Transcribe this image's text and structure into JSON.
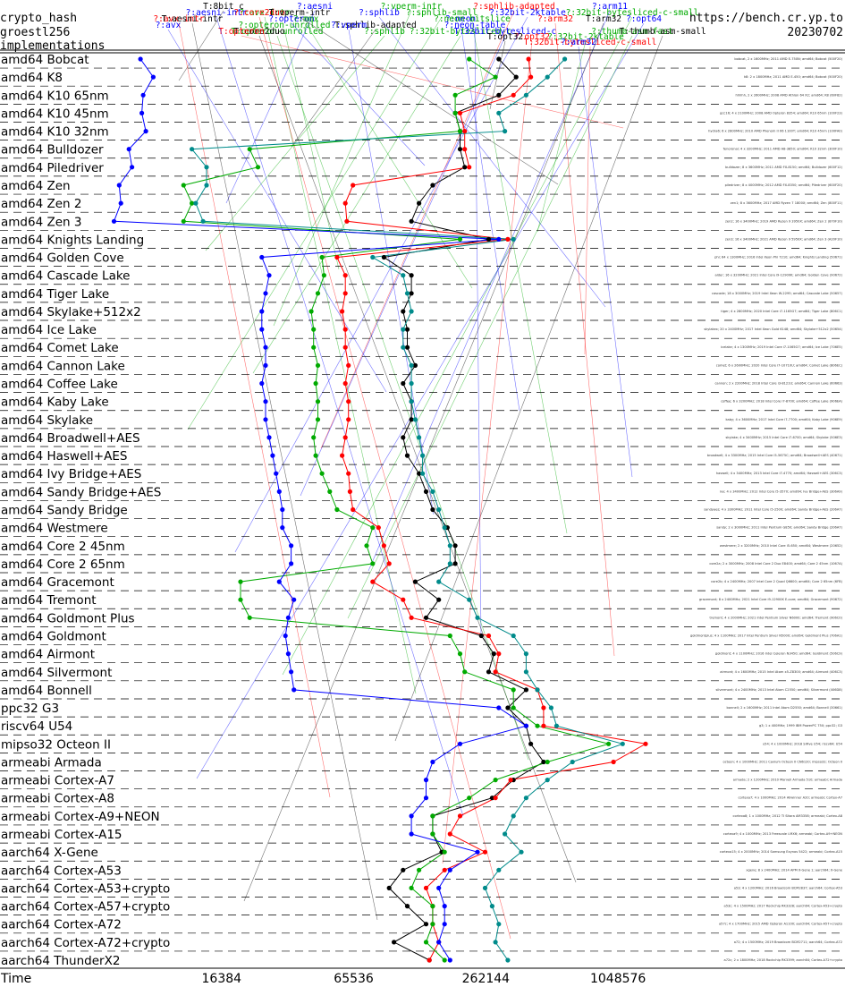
{
  "header": {
    "primitive": "crypto_hash",
    "function": "groestl256",
    "section": "implementations",
    "url": "https://bench.cr.yp.to",
    "date": "20230702"
  },
  "legend": [
    {
      "label": "T:8bit_c",
      "color": "#000000"
    },
    {
      "label": "?:aesni",
      "color": "#0000ff"
    },
    {
      "label": "?:vperm-intr",
      "color": "#00aa00"
    },
    {
      "label": "?:sphlib-adapted",
      "color": "#ff0000"
    },
    {
      "label": "?:arm11",
      "color": "#0000ff"
    },
    {
      "label": "?:avx-intr",
      "color": "#00aa00"
    },
    {
      "label": "?:aesni-intr",
      "color": "#0000ff"
    },
    {
      "label": "?:core2duo",
      "color": "#ff0000"
    },
    {
      "label": "T:vperm-intr",
      "color": "#000000"
    },
    {
      "label": "?:sphlib",
      "color": "#0000ff"
    },
    {
      "label": "?:sphlib-small",
      "color": "#00aa00"
    },
    {
      "label": "?:32bit-2ktable",
      "color": "#0000ff"
    },
    {
      "label": "?:32bit-bytesliced-c-small",
      "color": "#00aa00"
    },
    {
      "label": "?:avx-intr",
      "color": "#ff0000"
    },
    {
      "label": "T:aesni-intr",
      "color": "#000000"
    },
    {
      "label": "?:opteron",
      "color": "#0000ff"
    },
    {
      "label": "?:mmx",
      "color": "#00aa00"
    },
    {
      "label": "?:neon",
      "color": "#0000ff"
    },
    {
      "label": "?:neon-bitslice",
      "color": "#00aa00"
    },
    {
      "label": "?:arm32",
      "color": "#ff0000"
    },
    {
      "label": "?:opt64",
      "color": "#0000ff"
    },
    {
      "label": "T:arm32",
      "color": "#000000"
    },
    {
      "label": "T:sphlib-adapted",
      "color": "#000000"
    },
    {
      "label": "?:opteron-unrolled",
      "color": "#00aa00"
    },
    {
      "label": "?:avx",
      "color": "#0000ff"
    },
    {
      "label": "?:vperm",
      "color": "#0000ff"
    },
    {
      "label": "?:neon-table",
      "color": "#0000ff"
    },
    {
      "label": "T:opteron-unrolled",
      "color": "#00aa00"
    },
    {
      "label": "T:core2duo",
      "color": "#000000"
    },
    {
      "label": "T:opteron",
      "color": "#ff0000"
    },
    {
      "label": "?:sphlib",
      "color": "#00aa00"
    },
    {
      "label": "?:32bit-bytesliced-c",
      "color": "#00aa00"
    },
    {
      "label": "T:32bit-bytesliced-c",
      "color": "#0000ff"
    },
    {
      "label": "?:thumb-asm-fast",
      "color": "#00aa00"
    },
    {
      "label": "T:thumb-asm-small",
      "color": "#000000"
    },
    {
      "label": "?:opt32",
      "color": "#ff0000"
    },
    {
      "label": "T:opt32",
      "color": "#000000"
    },
    {
      "label": "?:32bit-2ktable",
      "color": "#00aa00"
    },
    {
      "label": "T:32bit-bytesliced-c-small",
      "color": "#ff0000"
    },
    {
      "label": "?:arm32",
      "color": "#0000ff"
    }
  ],
  "chart_data": {
    "type": "line",
    "title": "",
    "xlabel": "Time",
    "xscale": "log2",
    "xlim": [
      3800,
      2000000
    ],
    "xticks": [
      16384,
      65536,
      262144,
      1048576
    ],
    "xtick_labels": [
      "16384",
      "65536",
      "262144",
      "1048576"
    ],
    "grid": "dashed horizontal separators between rows",
    "categories": [
      "amd64 Bobcat",
      "amd64 K8",
      "amd64 K10 65nm",
      "amd64 K10 45nm",
      "amd64 K10 32nm",
      "amd64 Bulldozer",
      "amd64 Piledriver",
      "amd64 Zen",
      "amd64 Zen 2",
      "amd64 Zen 3",
      "amd64 Knights Landing",
      "amd64 Golden Cove",
      "amd64 Cascade Lake",
      "amd64 Tiger Lake",
      "amd64 Skylake+512x2",
      "amd64 Ice Lake",
      "amd64 Comet Lake",
      "amd64 Cannon Lake",
      "amd64 Coffee Lake",
      "amd64 Kaby Lake",
      "amd64 Skylake",
      "amd64 Broadwell+AES",
      "amd64 Haswell+AES",
      "amd64 Ivy Bridge+AES",
      "amd64 Sandy Bridge+AES",
      "amd64 Sandy Bridge",
      "amd64 Westmere",
      "amd64 Core 2 45nm",
      "amd64 Core 2 65nm",
      "amd64 Gracemont",
      "amd64 Tremont",
      "amd64 Goldmont Plus",
      "amd64 Goldmont",
      "amd64 Airmont",
      "amd64 Silvermont",
      "amd64 Bonnell",
      "ppc32 G3",
      "riscv64 U54",
      "mipso32 Octeon II",
      "armeabi Armada",
      "armeabi Cortex-A7",
      "armeabi Cortex-A8",
      "armeabi Cortex-A9+NEON",
      "armeabi Cortex-A15",
      "aarch64 X-Gene",
      "aarch64 Cortex-A53",
      "aarch64 Cortex-A53+crypto",
      "aarch64 Cortex-A57+crypto",
      "aarch64 Cortex-A72",
      "aarch64 Cortex-A72+crypto",
      "aarch64 ThunderX2"
    ],
    "series": [
      {
        "name": "8bit_c",
        "color": "#000000",
        "values": [
          300000,
          360000,
          300000,
          190000,
          200000,
          200000,
          210000,
          150000,
          130000,
          120000,
          270000,
          90000,
          120000,
          120000,
          110000,
          115000,
          115000,
          125000,
          110000,
          120000,
          120000,
          110000,
          115000,
          130000,
          140000,
          150000,
          175000,
          190000,
          190000,
          125000,
          160000,
          140000,
          250000,
          285000,
          270000,
          400000,
          330000,
          400000,
          420000,
          480000,
          350000,
          280000,
          150000,
          150000,
          165000,
          110000,
          95000,
          115000,
          140000,
          100000,
          145000
        ]
      },
      {
        "name": "sphlib-adapted",
        "color": "#ff0000",
        "values": [
          410000,
          420000,
          350000,
          200000,
          210000,
          210000,
          220000,
          65000,
          60000,
          61000,
          330000,
          55000,
          60000,
          60000,
          58000,
          60000,
          60000,
          62000,
          60000,
          62000,
          62000,
          60000,
          58000,
          62000,
          63000,
          65000,
          85000,
          90000,
          95000,
          80000,
          110000,
          120000,
          270000,
          300000,
          290000,
          450000,
          480000,
          480000,
          1400000,
          1000000,
          340000,
          290000,
          200000,
          180000,
          260000,
          170000,
          140000,
          150000,
          150000,
          160000,
          145000
        ]
      },
      {
        "name": "vperm-intr",
        "color": "#00aa00",
        "values": [
          220000,
          290000,
          190000,
          190000,
          200000,
          22000,
          24000,
          11000,
          12000,
          11000,
          200000,
          47000,
          48000,
          45000,
          42000,
          43000,
          43000,
          45000,
          44000,
          45000,
          45000,
          43000,
          44000,
          47000,
          51000,
          55000,
          80000,
          75000,
          80000,
          20000,
          20000,
          22000,
          180000,
          200000,
          210000,
          350000,
          350000,
          450000,
          950000,
          500000,
          290000,
          220000,
          150000,
          150000,
          170000,
          130000,
          120000,
          150000,
          150000,
          140000,
          170000
        ]
      },
      {
        "name": "opteron-unrolled",
        "color": "#008b8b",
        "values": [
          600000,
          500000,
          400000,
          300000,
          320000,
          12000,
          14000,
          14000,
          12500,
          13500,
          350000,
          80000,
          110000,
          115000,
          120000,
          110000,
          110000,
          120000,
          120000,
          120000,
          125000,
          130000,
          135000,
          135000,
          150000,
          160000,
          170000,
          180000,
          180000,
          160000,
          220000,
          240000,
          350000,
          400000,
          400000,
          450000,
          520000,
          550000,
          1100000,
          650000,
          500000,
          400000,
          350000,
          320000,
          380000,
          300000,
          260000,
          280000,
          300000,
          290000,
          330000
        ]
      },
      {
        "name": "aesni",
        "color": "#0000ff",
        "values": [
          7000,
          8000,
          7200,
          7100,
          7400,
          6200,
          6400,
          5600,
          5700,
          5300,
          300000,
          25000,
          27000,
          26000,
          25000,
          25000,
          26000,
          26000,
          25000,
          26000,
          26000,
          27000,
          28000,
          29000,
          30000,
          31000,
          31000,
          34000,
          34000,
          30000,
          35000,
          33000,
          32000,
          33000,
          34000,
          35000,
          300000,
          400000,
          200000,
          150000,
          140000,
          140000,
          120000,
          120000,
          240000,
          180000,
          160000,
          170000,
          170000,
          160000,
          180000
        ]
      }
    ]
  },
  "machines": [
    "bobcat, 2 x 1600MHz; 2011 AMD E-750N; amd64; Bobcat (500F20)",
    "k8: 2 x 1800MHz; 2011 AMD E-450; amd64; Bobcat (500F20)",
    "hhhhh, 2 x 2600MHz; 2008 AMD Athlon 64 X2; amd64; K8 (60F82)",
    "gcc16; 4 x 2100MHz; 2008 AMD Opteron 8354; amd64; K10 65nm (100F23)",
    "hydra6; 6 x 2800MHz; 2010 AMD Phenom II X6 1100T; amd64; K10 45nm (100FA0)",
    "fenoronal; 4 x 3200MHz; 2011 AMD A8-3850; amd64; K10 32nm (300F10)",
    "bulldozer; 8 x 3600MHz; 2011 AMD FX-8150; amd64; Bulldozer (600F12)",
    "piledriver; 8 x 4000MHz; 2012 AMD FX-8350; amd64; Piledriver (600F20)",
    "zen1; 8 x 3600MHz; 2017 AMD Ryzen 7 1800X; amd64; Zen (800F11)",
    "zen2; 16 x 3400MHz; 2019 AMD Ryzen 9 3950X; amd64; Zen 2 (870F10)",
    "zen3; 16 x 3400MHz; 2021 AMD Ryzen 9 5950X; amd64; Zen 3 (A20F10)",
    "phi; 64 x 1300MHz; 2016 Intel Xeon Phi 7210; amd64; Knights Landing (50671)",
    "alder; 16 x 3200MHz; 2021 Intel Core i9-12900K; amd64; Golden Cove (90672)",
    "cascade; 18 x 3000MHz; 2019 Intel Xeon W-2295; amd64; Cascade Lake (50657)",
    "tiger; 4 x 2800MHz; 2020 Intel Core i7-1165G7; amd64; Tiger Lake (806C1)",
    "skylakex; 20 x 2400MHz; 2017 Intel Xeon Gold 6148; amd64; Skylake+512x2 (50654)",
    "icelake; 4 x 1300MHz; 2019 Intel Core i7-1065G7; amd64; Ice Lake (706E5)",
    "comet; 6 x 2600MHz; 2020 Intel Core i7-10710U; amd64; Comet Lake (806EC)",
    "cannon; 2 x 2200MHz; 2018 Intel Core i3-8121U; amd64; Cannon Lake (60663)",
    "coffee; 6 x 3200MHz; 2018 Intel Core i7-8700; amd64; Coffee Lake (906EA)",
    "kaby; 4 x 3600MHz; 2017 Intel Core i7-7700; amd64; Kaby Lake (906E9)",
    "skylake; 4 x 3400MHz; 2015 Intel Core i7-6700; amd64; Skylake (506E3)",
    "broadwell; 4 x 3300MHz; 2015 Intel Core i5-5675C; amd64; Broadwell+AES (40671)",
    "haswell; 4 x 3400MHz; 2013 Intel Core i7-4770; amd64; Haswell+AES (306C3)",
    "ivy; 4 x 3400MHz; 2012 Intel Core i5-3570; amd64; Ivy Bridge+AES (306A9)",
    "sandyaes; 4 x 3300MHz; 2011 Intel Core i5-2500; amd64; Sandy Bridge+AES (206A7)",
    "sandy; 2 x 3000MHz; 2011 Intel Pentium G850; amd64; Sandy Bridge (206A7)",
    "westmere; 2 x 3200MHz; 2010 Intel Core i5-650; amd64; Westmere (20652)",
    "core2a; 2 x 3000MHz; 2008 Intel Core 2 Duo E8400; amd64; Core 2 45nm (1067A)",
    "core2b; 4 x 2400MHz; 2007 Intel Core 2 Quad Q6600; amd64; Core 2 65nm (6FB)",
    "gracemont; 8 x 2400MHz; 2021 Intel Core i9-12900K E-core; amd64; Gracemont (90672)",
    "tremont; 4 x 2000MHz; 2021 Intel Pentium Silver N6000; amd64; Tremont (906C0)",
    "goldmontplus; 4 x 1100MHz; 2017 Intel Pentium Silver N5000; amd64; Goldmont Plus (706A1)",
    "goldmont; 4 x 1100MHz; 2016 Intel Celeron N3450; amd64; Goldmont (506C9)",
    "airmont; 4 x 1600MHz; 2015 Intel Atom x5-Z8300; amd64; Airmont (406C3)",
    "silvermont; 4 x 2400MHz; 2013 Intel Atom C2550; amd64; Silvermont (406D8)",
    "bonnell; 2 x 1600MHz; 2011 Intel Atom D2550; amd64; Bonnell (30661)",
    "g3; 1 x 400MHz; 1999 IBM PowerPC 750; ppc32; G3",
    "u54; 4 x 1000MHz; 2018 SiFive U54; riscv64; U54",
    "octeon; 4 x 1000MHz; 2011 Cavium Octeon II CN6120; mipso32; Octeon II",
    "armada; 2 x 1200MHz; 2010 Marvell Armada 510; armeabi; Armada",
    "cortexa7; 4 x 1000MHz; 2014 Allwinner A20; armeabi; Cortex-A7",
    "cortexa8; 1 x 1000MHz; 2012 TI Sitara AM3358; armeabi; Cortex-A8",
    "cortexa9; 4 x 1000MHz; 2013 Freescale i.MX6; armeabi; Cortex-A9+NEON",
    "cortexa15; 4 x 2000MHz; 2014 Samsung Exynos 5422; armeabi; Cortex-A15",
    "xgene; 8 x 2400MHz; 2014 APM X-Gene 1; aarch64; X-Gene",
    "a53; 4 x 1200MHz; 2016 Broadcom BCM2837; aarch64; Cortex-A53",
    "a53c; 4 x 1500MHz; 2017 Rockchip RK3328; aarch64; Cortex-A53+crypto",
    "a57c; 4 x 1700MHz; 2015 AMD Opteron A1100; aarch64; Cortex-A57+crypto",
    "a72; 4 x 1500MHz; 2019 Broadcom BCM2711; aarch64; Cortex-A72",
    "a72c; 2 x 1800MHz; 2018 Rockchip RK3399; aarch64; Cortex-A72+crypto",
    "thunderx2; 56 x 2500MHz; 2018 Cavium ThunderX2 CN9980; aarch64; ThunderX2"
  ]
}
